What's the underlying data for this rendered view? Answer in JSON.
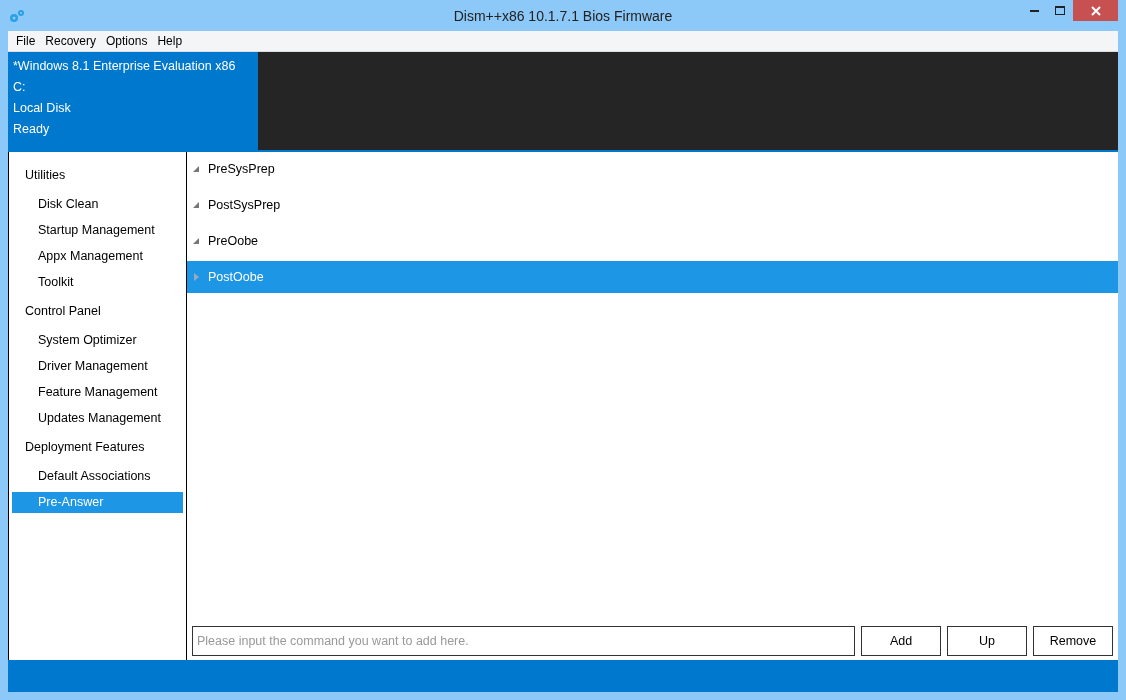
{
  "window": {
    "title": "Dism++x86 10.1.7.1 Bios Firmware"
  },
  "menu": [
    "File",
    "Recovery",
    "Options",
    "Help"
  ],
  "image_info": [
    "*Windows 8.1 Enterprise Evaluation x86",
    "C:",
    "Local Disk",
    "Ready"
  ],
  "sidebar": {
    "groups": [
      {
        "title": "Utilities",
        "items": [
          {
            "label": "Disk Clean",
            "selected": false
          },
          {
            "label": "Startup Management",
            "selected": false
          },
          {
            "label": "Appx Management",
            "selected": false
          },
          {
            "label": "Toolkit",
            "selected": false
          }
        ]
      },
      {
        "title": "Control Panel",
        "items": [
          {
            "label": "System Optimizer",
            "selected": false
          },
          {
            "label": "Driver Management",
            "selected": false
          },
          {
            "label": "Feature Management",
            "selected": false
          },
          {
            "label": "Updates Management",
            "selected": false
          }
        ]
      },
      {
        "title": "Deployment Features",
        "items": [
          {
            "label": "Default Associations",
            "selected": false
          },
          {
            "label": "Pre-Answer",
            "selected": true
          }
        ]
      }
    ]
  },
  "tree": [
    {
      "label": "PreSysPrep",
      "expanded": true,
      "selected": false
    },
    {
      "label": "PostSysPrep",
      "expanded": true,
      "selected": false
    },
    {
      "label": "PreOobe",
      "expanded": true,
      "selected": false
    },
    {
      "label": "PostOobe",
      "expanded": false,
      "selected": true
    }
  ],
  "command": {
    "placeholder": "Please input the command you want to add here."
  },
  "buttons": [
    "Add",
    "Up",
    "Remove"
  ]
}
